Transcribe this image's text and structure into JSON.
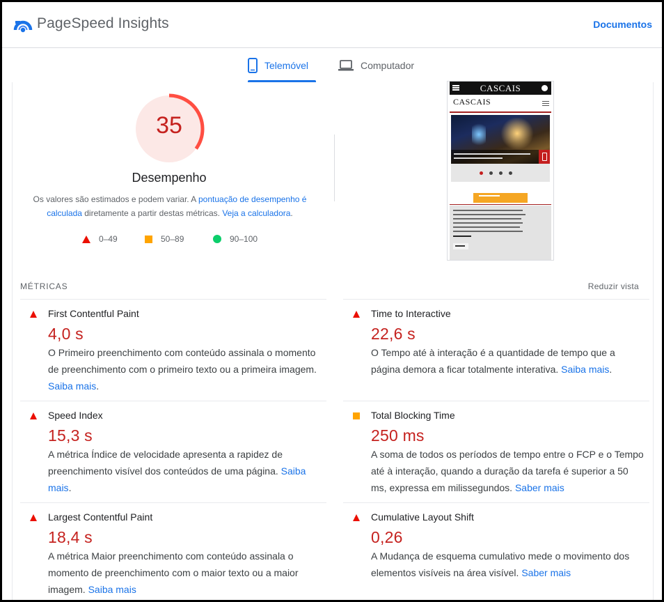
{
  "header": {
    "brand": "PageSpeed Insights",
    "docs_label": "Documentos"
  },
  "tabs": [
    {
      "label": "Telemóvel",
      "icon": "smartphone-icon",
      "selected": true
    },
    {
      "label": "Computador",
      "icon": "laptop-icon",
      "selected": false
    }
  ],
  "score": {
    "value": "35",
    "fraction": 0.35,
    "label": "Desempenho",
    "desc_prefix": "Os valores são estimados e podem variar. A ",
    "desc_link1": "pontuação de desempenho é calculada",
    "desc_mid": " diretamente a partir destas métricas. ",
    "desc_link2": "Veja a calculadora",
    "desc_suffix": "."
  },
  "legend": [
    {
      "range": "0–49",
      "shape": "triangle",
      "color": "#eb0f00"
    },
    {
      "range": "50–89",
      "shape": "square",
      "color": "#ffa400"
    },
    {
      "range": "90–100",
      "shape": "circle",
      "color": "#0cce6b"
    }
  ],
  "screenshot": {
    "site_title": "CASCAIS",
    "site_logo": "CASCAIS"
  },
  "metrics_section": {
    "heading": "MÉTRICAS",
    "toggle_label": "Reduzir vista"
  },
  "metrics": {
    "fcp": {
      "title": "First Contentful Paint",
      "value": "4,0 s",
      "desc": "O Primeiro preenchimento com conteúdo assinala o momento de preenchimento com o primeiro texto ou a primeira imagem. ",
      "link": "Saiba mais",
      "suffix": ".",
      "rating": "fail"
    },
    "tti": {
      "title": "Time to Interactive",
      "value": "22,6 s",
      "desc": "O Tempo até à interação é a quantidade de tempo que a página demora a ficar totalmente interativa. ",
      "link": "Saiba mais",
      "suffix": ".",
      "rating": "fail"
    },
    "si": {
      "title": "Speed Index",
      "value": "15,3 s",
      "desc": "A métrica Índice de velocidade apresenta a rapidez de preenchimento visível dos conteúdos de uma página. ",
      "link": "Saiba mais",
      "suffix": ".",
      "rating": "fail"
    },
    "tbt": {
      "title": "Total Blocking Time",
      "value": "250 ms",
      "desc": "A soma de todos os períodos de tempo entre o FCP e o Tempo até à interação, quando a duração da tarefa é superior a 50 ms, expressa em milissegundos. ",
      "link": "Saber mais",
      "suffix": "",
      "rating": "average"
    },
    "lcp": {
      "title": "Largest Contentful Paint",
      "value": "18,4 s",
      "desc": "A métrica Maior preenchimento com conteúdo assinala o momento de preenchimento com o maior texto ou a maior imagem. ",
      "link": "Saiba mais",
      "suffix": "",
      "rating": "fail"
    },
    "cls": {
      "title": "Cumulative Layout Shift",
      "value": "0,26",
      "desc": "A Mudança de esquema cumulativo mede o movimento dos elementos visíveis na área visível. ",
      "link": "Saber mais",
      "suffix": "",
      "rating": "fail"
    }
  },
  "colors": {
    "accent": "#1a73e8",
    "fail": "#c5221f",
    "fail_icon": "#eb0f00",
    "average_icon": "#ffa400",
    "pass_icon": "#0cce6b",
    "gauge_bg": "#fce8e6",
    "gauge_arc": "#ff4e42"
  }
}
